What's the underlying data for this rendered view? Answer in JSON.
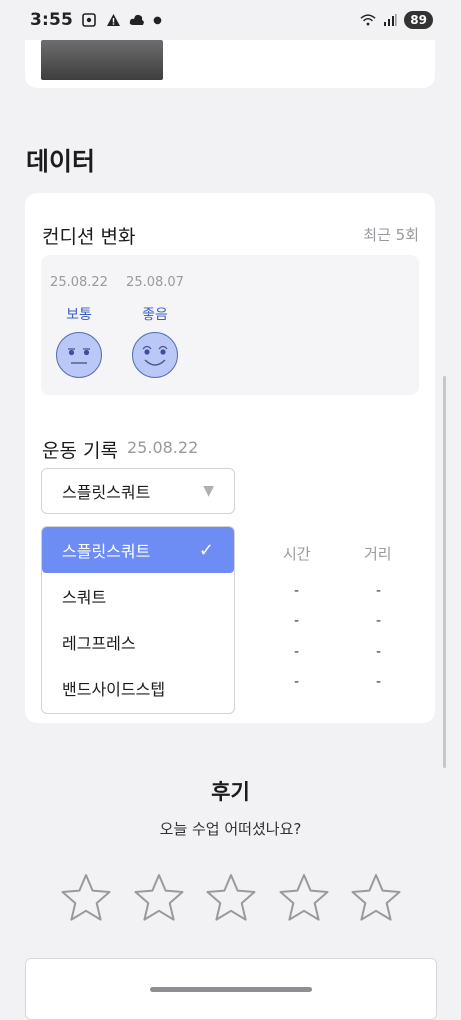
{
  "status_bar": {
    "time": "3:55",
    "battery": "89",
    "icons": [
      "screenshot-icon",
      "alert-icon",
      "cloud-icon",
      "dot-icon",
      "wifi-icon",
      "signal-icon"
    ]
  },
  "data_section": {
    "title": "데이터",
    "condition": {
      "title": "컨디션 변화",
      "recent": "최근 5회",
      "items": [
        {
          "date": "25.08.22",
          "label": "보통",
          "face": "neutral-face-icon"
        },
        {
          "date": "25.08.07",
          "label": "좋음",
          "face": "smile-face-icon"
        }
      ]
    },
    "exercise": {
      "title": "운동 기록",
      "date": "25.08.22",
      "selected": "스플릿스쿼트",
      "options": [
        "스플릿스쿼트",
        "스쿼트",
        "레그프레스",
        "밴드사이드스텝"
      ],
      "columns": [
        "시간",
        "거리"
      ],
      "rows": [
        [
          "-",
          "-"
        ],
        [
          "-",
          "-"
        ],
        [
          "-",
          "-"
        ],
        [
          "-",
          "-"
        ]
      ]
    }
  },
  "review": {
    "title": "후기",
    "subtitle": "오늘 수업 어떠셨나요?",
    "rating": 0,
    "max_rating": 5
  },
  "colors": {
    "accent": "#6d8cf4",
    "face_fill": "#b9c8f7",
    "label_blue": "#3b5fc4",
    "background": "#f2f2f4"
  }
}
